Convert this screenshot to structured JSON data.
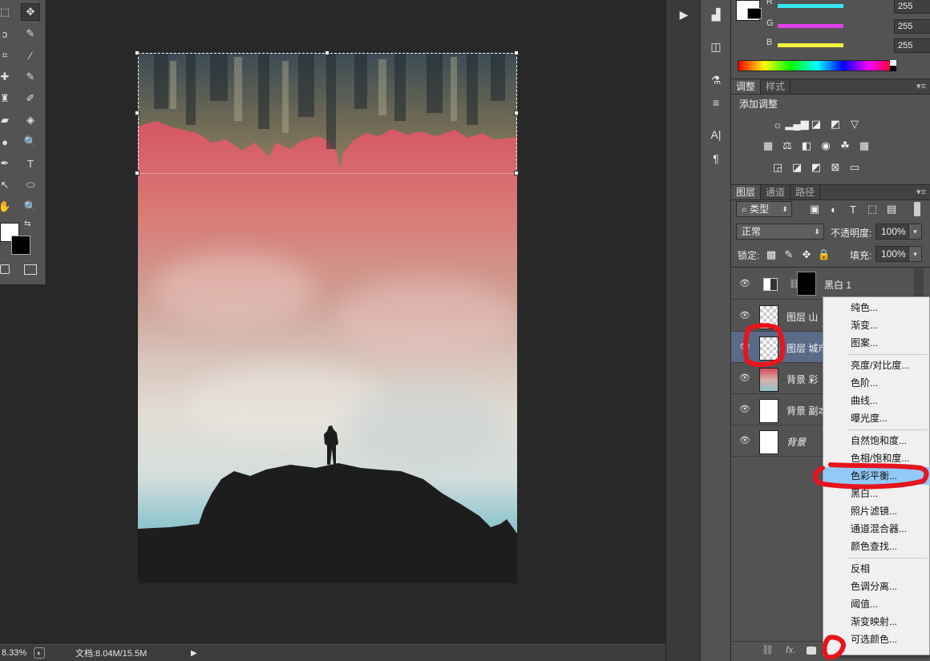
{
  "toolbar": {
    "tools": [
      {
        "name": "marquee-tool-icon",
        "glyph": "⬚"
      },
      {
        "name": "move-tool-icon",
        "glyph": "✥"
      },
      {
        "name": "lasso-tool-icon",
        "glyph": "ↄ"
      },
      {
        "name": "quick-select-tool-icon",
        "glyph": "✎"
      },
      {
        "name": "crop-tool-icon",
        "glyph": "⌗"
      },
      {
        "name": "eyedropper-tool-icon",
        "glyph": "⁄"
      },
      {
        "name": "healing-brush-icon",
        "glyph": "✚"
      },
      {
        "name": "brush-tool-icon",
        "glyph": "✎"
      },
      {
        "name": "stamp-tool-icon",
        "glyph": "♜"
      },
      {
        "name": "history-brush-icon",
        "glyph": "✐"
      },
      {
        "name": "eraser-tool-icon",
        "glyph": "▰"
      },
      {
        "name": "paint-bucket-icon",
        "glyph": "◈"
      },
      {
        "name": "blur-tool-icon",
        "glyph": "●"
      },
      {
        "name": "dodge-tool-icon",
        "glyph": "🔍"
      },
      {
        "name": "pen-tool-icon",
        "glyph": "✒"
      },
      {
        "name": "type-tool-icon",
        "glyph": "T"
      },
      {
        "name": "path-select-icon",
        "glyph": "↖"
      },
      {
        "name": "ellipse-tool-icon",
        "glyph": "⬭"
      },
      {
        "name": "hand-tool-icon",
        "glyph": "✋"
      },
      {
        "name": "zoom-tool-icon",
        "glyph": "🔍"
      }
    ]
  },
  "status": {
    "zoom": "8.33%",
    "doc_info": "文档:8.04M/15.5M"
  },
  "color_panel": {
    "channels": [
      {
        "label": "R",
        "value": "255",
        "color": "#38e8f0"
      },
      {
        "label": "G",
        "value": "255",
        "color": "#e040e8"
      },
      {
        "label": "B",
        "value": "255",
        "color": "#f0f040"
      }
    ]
  },
  "adjustments_panel": {
    "tabs": [
      "调整",
      "样式"
    ],
    "title": "添加调整"
  },
  "layers_panel": {
    "tabs": [
      "图层",
      "通道",
      "路径"
    ],
    "filter_kind": "类型",
    "blend_mode": "正常",
    "opacity_label": "不透明度:",
    "opacity_value": "100%",
    "lock_label": "锁定:",
    "fill_label": "填充:",
    "fill_value": "100%",
    "layers": [
      {
        "name": "黑白 1",
        "selected": false
      },
      {
        "name": "图层 山",
        "selected": false
      },
      {
        "name": "图层 城市",
        "selected": true
      },
      {
        "name": "背景 彩",
        "selected": false
      },
      {
        "name": "背景 副本",
        "selected": false
      },
      {
        "name": "背景",
        "selected": false
      }
    ],
    "footer_icons": [
      "link-icon",
      "fx-icon",
      "mask-icon"
    ],
    "fx_label": "fx."
  },
  "context_menu": {
    "items": [
      {
        "label": "纯色...",
        "group": 1
      },
      {
        "label": "渐变...",
        "group": 1
      },
      {
        "label": "图案...",
        "group": 1
      },
      {
        "label": "亮度/对比度...",
        "group": 2
      },
      {
        "label": "色阶...",
        "group": 2
      },
      {
        "label": "曲线...",
        "group": 2
      },
      {
        "label": "曝光度...",
        "group": 2
      },
      {
        "label": "自然饱和度...",
        "group": 3
      },
      {
        "label": "色相/饱和度...",
        "group": 3
      },
      {
        "label": "色彩平衡...",
        "group": 3,
        "highlighted": true
      },
      {
        "label": "黑白...",
        "group": 3
      },
      {
        "label": "照片滤镜...",
        "group": 3
      },
      {
        "label": "通道混合器...",
        "group": 3
      },
      {
        "label": "颜色查找...",
        "group": 3
      },
      {
        "label": "反相",
        "group": 4
      },
      {
        "label": "色调分离...",
        "group": 4
      },
      {
        "label": "阈值...",
        "group": 4
      },
      {
        "label": "渐变映射...",
        "group": 4
      },
      {
        "label": "可选颜色...",
        "group": 4
      }
    ]
  }
}
